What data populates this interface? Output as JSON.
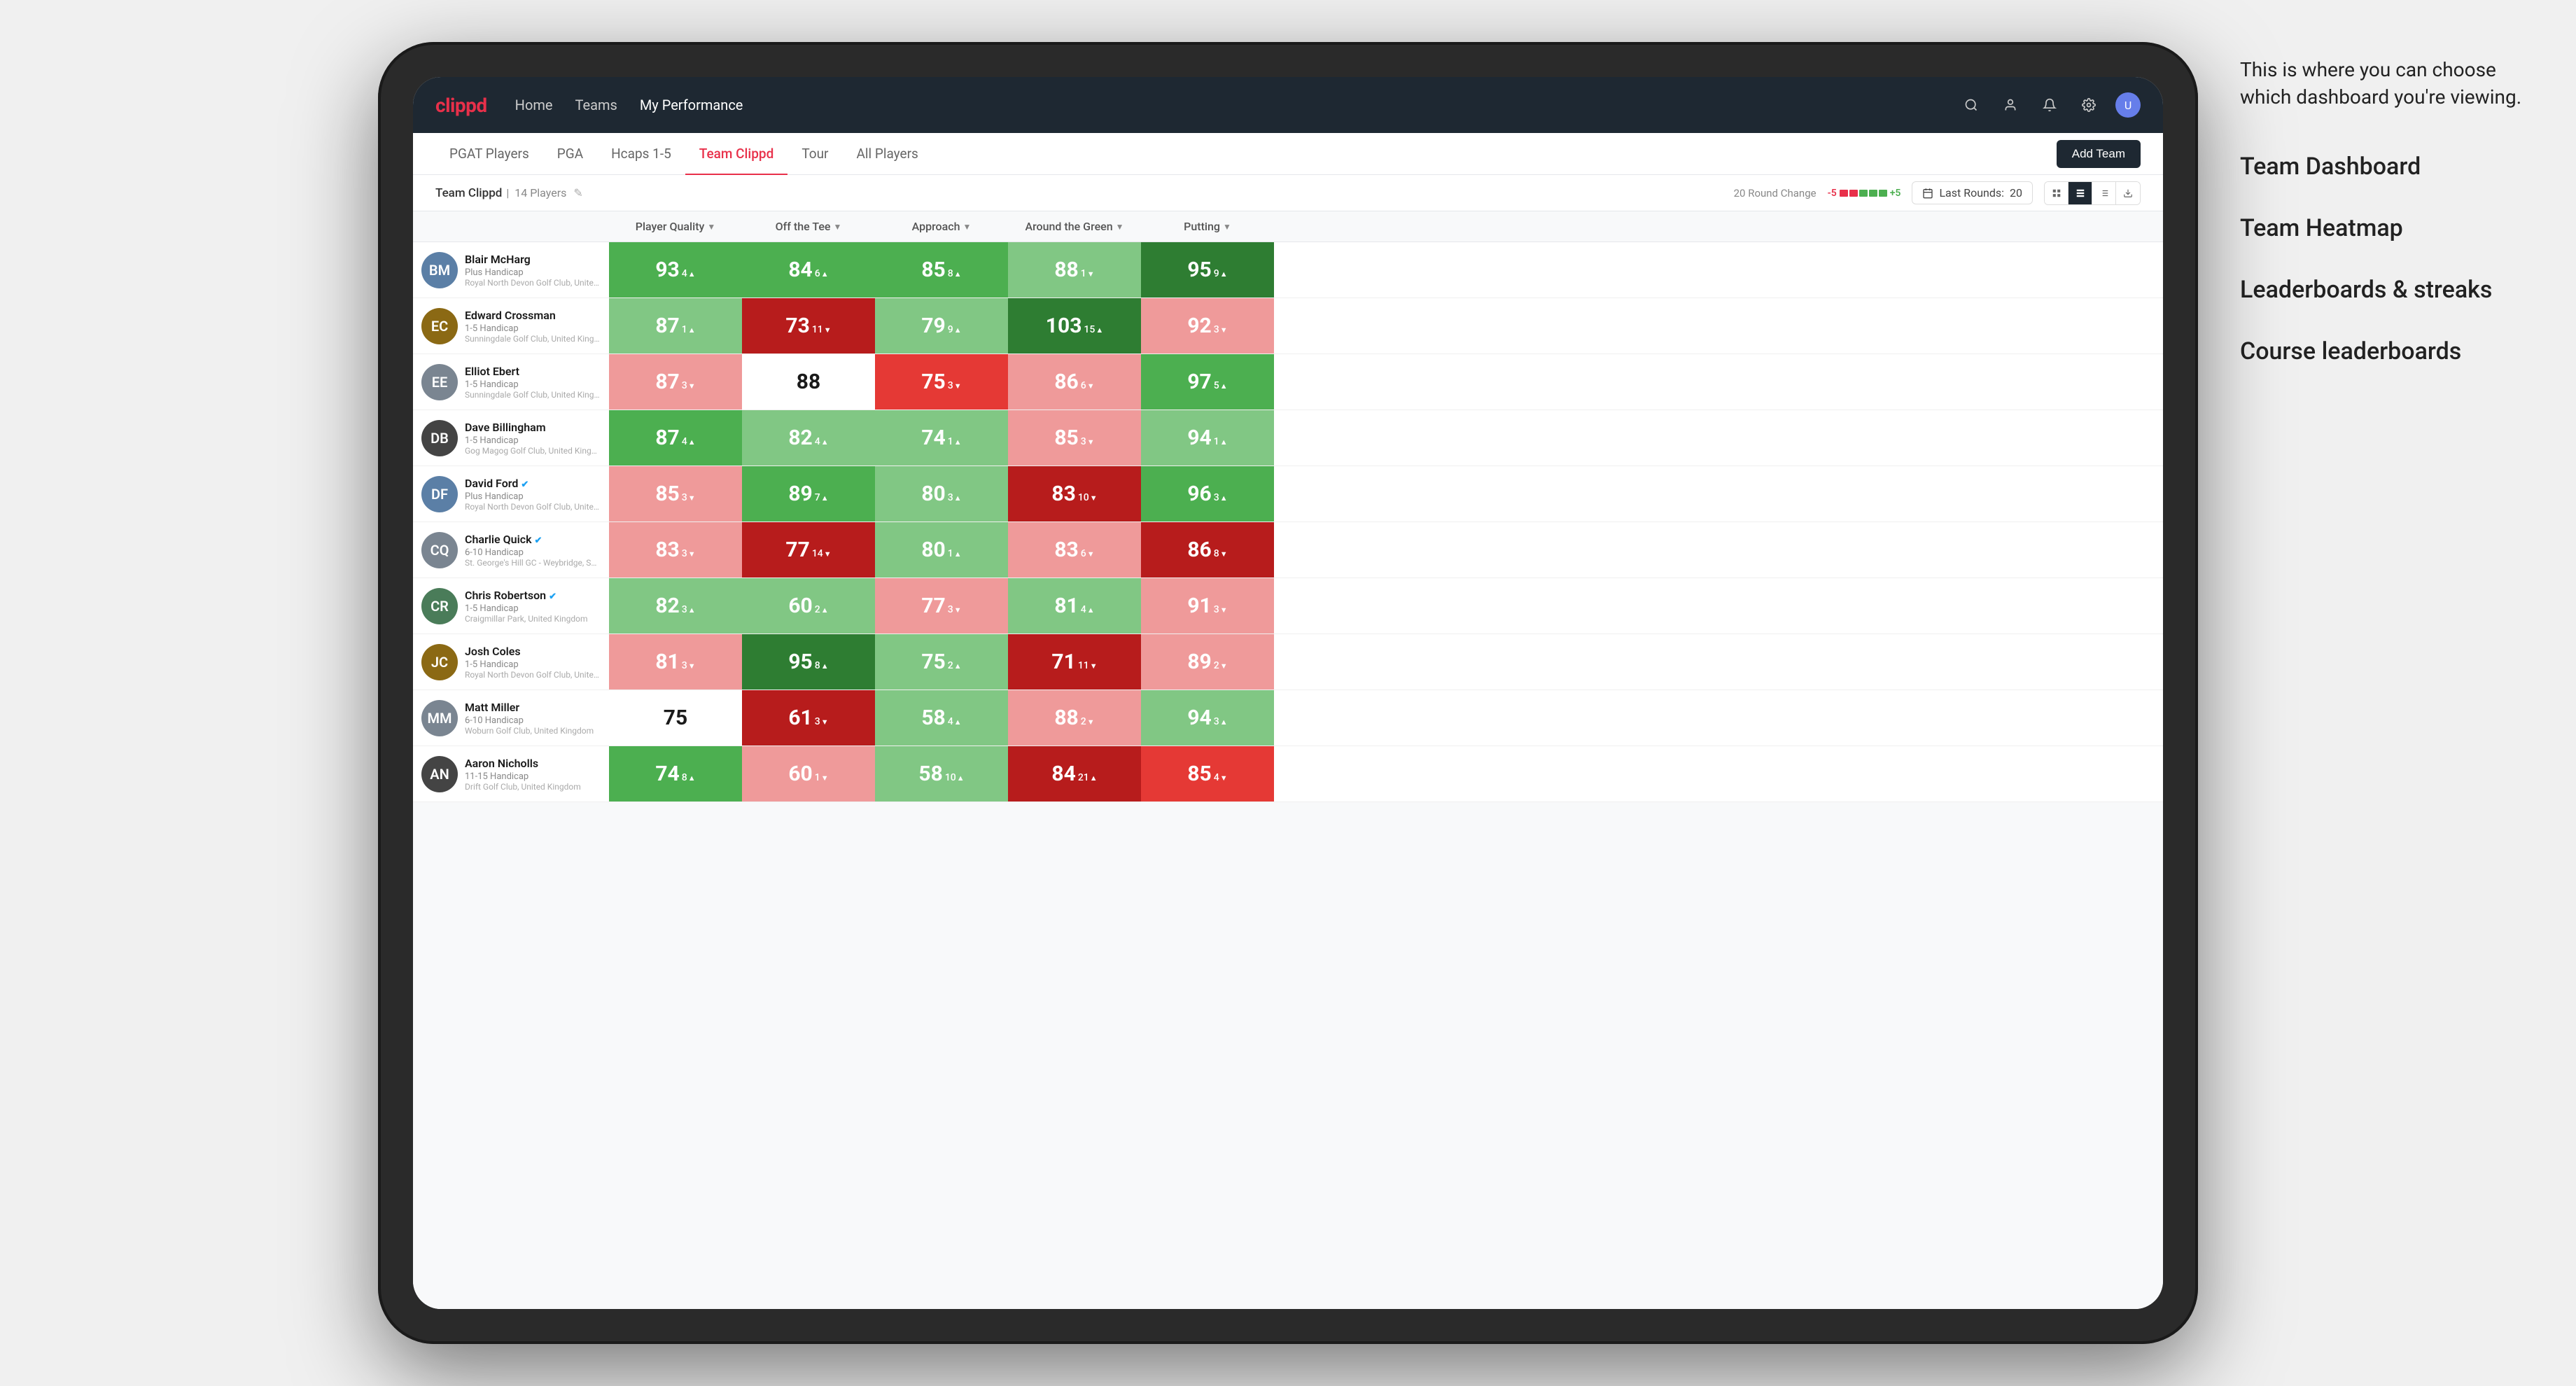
{
  "annotation": {
    "intro": "This is where you can choose which dashboard you're viewing.",
    "options": [
      "Team Dashboard",
      "Team Heatmap",
      "Leaderboards & streaks",
      "Course leaderboards"
    ]
  },
  "navbar": {
    "logo": "clippd",
    "nav_items": [
      "Home",
      "Teams",
      "My Performance"
    ],
    "active_nav": "My Performance"
  },
  "sub_tabs": {
    "tabs": [
      "PGAT Players",
      "PGA",
      "Hcaps 1-5",
      "Team Clippd",
      "Tour",
      "All Players"
    ],
    "active_tab": "Team Clippd",
    "add_team_label": "Add Team"
  },
  "team_bar": {
    "team_name": "Team Clippd",
    "player_count": "14 Players",
    "round_change_label": "20 Round Change",
    "round_change_neg": "-5",
    "round_change_pos": "+5",
    "last_rounds_label": "Last Rounds:",
    "last_rounds_value": "20"
  },
  "table": {
    "columns": [
      {
        "label": "Player Quality",
        "key": "player_quality",
        "has_arrow": true
      },
      {
        "label": "Off the Tee",
        "key": "off_tee",
        "has_arrow": true
      },
      {
        "label": "Approach",
        "key": "approach",
        "has_arrow": true
      },
      {
        "label": "Around the Green",
        "key": "around_green",
        "has_arrow": true
      },
      {
        "label": "Putting",
        "key": "putting",
        "has_arrow": true
      }
    ],
    "players": [
      {
        "name": "Blair McHarg",
        "handicap": "Plus Handicap",
        "club": "Royal North Devon Golf Club, United Kingdom",
        "avatar_color": "av-blue",
        "initials": "BM",
        "scores": [
          {
            "value": "93",
            "change": "4",
            "dir": "up",
            "color": "green-mid"
          },
          {
            "value": "84",
            "change": "6",
            "dir": "up",
            "color": "green-mid"
          },
          {
            "value": "85",
            "change": "8",
            "dir": "up",
            "color": "green-mid"
          },
          {
            "value": "88",
            "change": "1",
            "dir": "down",
            "color": "green-light"
          },
          {
            "value": "95",
            "change": "9",
            "dir": "up",
            "color": "green-dark"
          }
        ]
      },
      {
        "name": "Edward Crossman",
        "handicap": "1-5 Handicap",
        "club": "Sunningdale Golf Club, United Kingdom",
        "avatar_color": "av-brown",
        "initials": "EC",
        "scores": [
          {
            "value": "87",
            "change": "1",
            "dir": "up",
            "color": "green-light"
          },
          {
            "value": "73",
            "change": "11",
            "dir": "down",
            "color": "red-dark"
          },
          {
            "value": "79",
            "change": "9",
            "dir": "up",
            "color": "green-light"
          },
          {
            "value": "103",
            "change": "15",
            "dir": "up",
            "color": "green-dark"
          },
          {
            "value": "92",
            "change": "3",
            "dir": "down",
            "color": "red-light"
          }
        ]
      },
      {
        "name": "Elliot Ebert",
        "handicap": "1-5 Handicap",
        "club": "Sunningdale Golf Club, United Kingdom",
        "avatar_color": "av-gray",
        "initials": "EE",
        "scores": [
          {
            "value": "87",
            "change": "3",
            "dir": "down",
            "color": "red-light"
          },
          {
            "value": "88",
            "change": "",
            "dir": "none",
            "color": "neutral"
          },
          {
            "value": "75",
            "change": "3",
            "dir": "down",
            "color": "red-mid"
          },
          {
            "value": "86",
            "change": "6",
            "dir": "down",
            "color": "red-light"
          },
          {
            "value": "97",
            "change": "5",
            "dir": "up",
            "color": "green-mid"
          }
        ]
      },
      {
        "name": "Dave Billingham",
        "handicap": "1-5 Handicap",
        "club": "Gog Magog Golf Club, United Kingdom",
        "avatar_color": "av-dark",
        "initials": "DB",
        "scores": [
          {
            "value": "87",
            "change": "4",
            "dir": "up",
            "color": "green-mid"
          },
          {
            "value": "82",
            "change": "4",
            "dir": "up",
            "color": "green-light"
          },
          {
            "value": "74",
            "change": "1",
            "dir": "up",
            "color": "green-light"
          },
          {
            "value": "85",
            "change": "3",
            "dir": "down",
            "color": "red-light"
          },
          {
            "value": "94",
            "change": "1",
            "dir": "up",
            "color": "green-light"
          }
        ]
      },
      {
        "name": "David Ford",
        "handicap": "Plus Handicap",
        "club": "Royal North Devon Golf Club, United Kingdom",
        "avatar_color": "av-blue",
        "initials": "DF",
        "verified": true,
        "scores": [
          {
            "value": "85",
            "change": "3",
            "dir": "down",
            "color": "red-light"
          },
          {
            "value": "89",
            "change": "7",
            "dir": "up",
            "color": "green-mid"
          },
          {
            "value": "80",
            "change": "3",
            "dir": "up",
            "color": "green-light"
          },
          {
            "value": "83",
            "change": "10",
            "dir": "down",
            "color": "red-dark"
          },
          {
            "value": "96",
            "change": "3",
            "dir": "up",
            "color": "green-mid"
          }
        ]
      },
      {
        "name": "Charlie Quick",
        "handicap": "6-10 Handicap",
        "club": "St. George's Hill GC - Weybridge, Surrey, Uni...",
        "avatar_color": "av-gray",
        "initials": "CQ",
        "verified": true,
        "scores": [
          {
            "value": "83",
            "change": "3",
            "dir": "down",
            "color": "red-light"
          },
          {
            "value": "77",
            "change": "14",
            "dir": "down",
            "color": "red-dark"
          },
          {
            "value": "80",
            "change": "1",
            "dir": "up",
            "color": "green-light"
          },
          {
            "value": "83",
            "change": "6",
            "dir": "down",
            "color": "red-light"
          },
          {
            "value": "86",
            "change": "8",
            "dir": "down",
            "color": "red-dark"
          }
        ]
      },
      {
        "name": "Chris Robertson",
        "handicap": "1-5 Handicap",
        "club": "Craigmillar Park, United Kingdom",
        "avatar_color": "av-green",
        "initials": "CR",
        "verified": true,
        "scores": [
          {
            "value": "82",
            "change": "3",
            "dir": "up",
            "color": "green-light"
          },
          {
            "value": "60",
            "change": "2",
            "dir": "up",
            "color": "green-light"
          },
          {
            "value": "77",
            "change": "3",
            "dir": "down",
            "color": "red-light"
          },
          {
            "value": "81",
            "change": "4",
            "dir": "up",
            "color": "green-light"
          },
          {
            "value": "91",
            "change": "3",
            "dir": "down",
            "color": "red-light"
          }
        ]
      },
      {
        "name": "Josh Coles",
        "handicap": "1-5 Handicap",
        "club": "Royal North Devon Golf Club, United Kingdom",
        "avatar_color": "av-brown",
        "initials": "JC",
        "scores": [
          {
            "value": "81",
            "change": "3",
            "dir": "down",
            "color": "red-light"
          },
          {
            "value": "95",
            "change": "8",
            "dir": "up",
            "color": "green-dark"
          },
          {
            "value": "75",
            "change": "2",
            "dir": "up",
            "color": "green-light"
          },
          {
            "value": "71",
            "change": "11",
            "dir": "down",
            "color": "red-dark"
          },
          {
            "value": "89",
            "change": "2",
            "dir": "down",
            "color": "red-light"
          }
        ]
      },
      {
        "name": "Matt Miller",
        "handicap": "6-10 Handicap",
        "club": "Woburn Golf Club, United Kingdom",
        "avatar_color": "av-gray",
        "initials": "MM",
        "scores": [
          {
            "value": "75",
            "change": "",
            "dir": "none",
            "color": "neutral"
          },
          {
            "value": "61",
            "change": "3",
            "dir": "down",
            "color": "red-dark"
          },
          {
            "value": "58",
            "change": "4",
            "dir": "up",
            "color": "green-light"
          },
          {
            "value": "88",
            "change": "2",
            "dir": "down",
            "color": "red-light"
          },
          {
            "value": "94",
            "change": "3",
            "dir": "up",
            "color": "green-light"
          }
        ]
      },
      {
        "name": "Aaron Nicholls",
        "handicap": "11-15 Handicap",
        "club": "Drift Golf Club, United Kingdom",
        "avatar_color": "av-dark",
        "initials": "AN",
        "scores": [
          {
            "value": "74",
            "change": "8",
            "dir": "up",
            "color": "green-mid"
          },
          {
            "value": "60",
            "change": "1",
            "dir": "down",
            "color": "red-light"
          },
          {
            "value": "58",
            "change": "10",
            "dir": "up",
            "color": "green-light"
          },
          {
            "value": "84",
            "change": "21",
            "dir": "up",
            "color": "red-dark"
          },
          {
            "value": "85",
            "change": "4",
            "dir": "down",
            "color": "red-mid"
          }
        ]
      }
    ]
  }
}
